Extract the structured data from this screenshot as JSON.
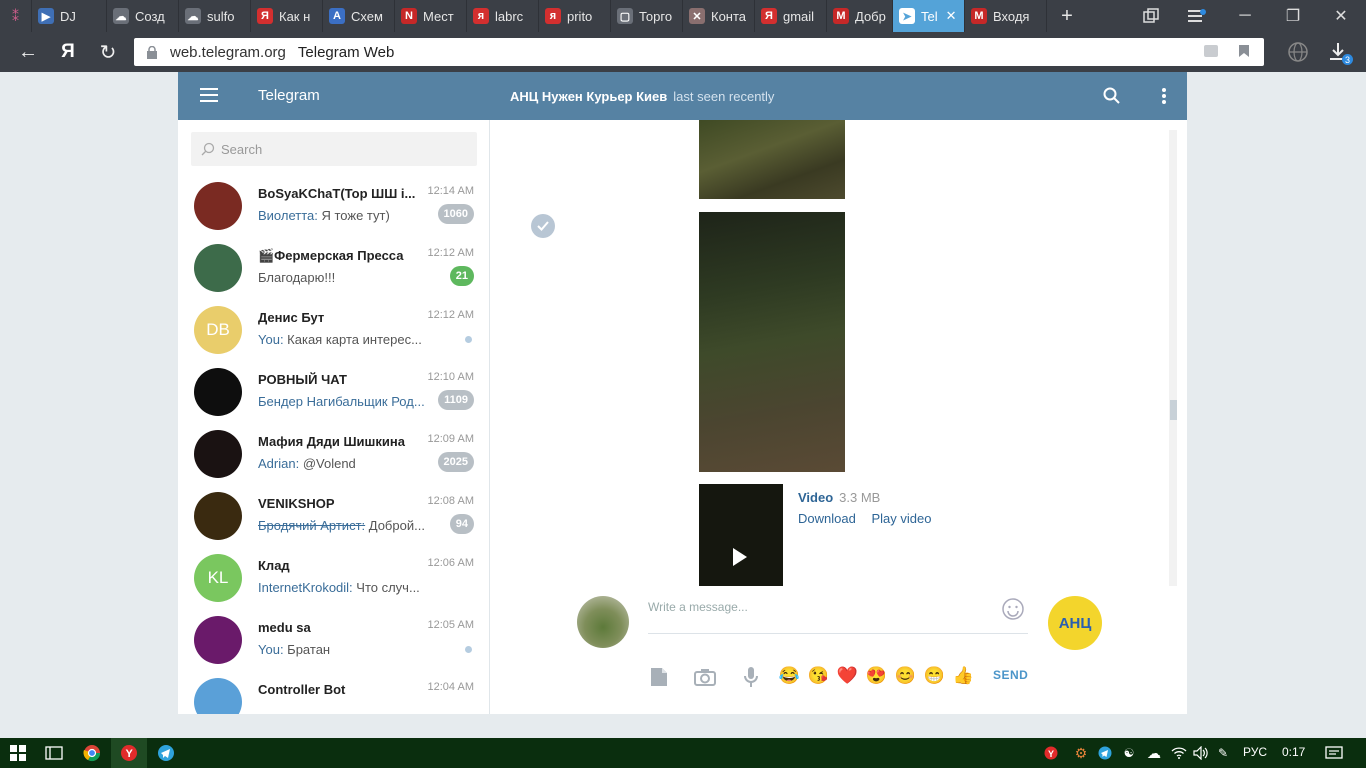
{
  "browser": {
    "tabs": [
      {
        "label": "DJ",
        "fav_color": "#3f6fb5",
        "fav_glyph": "▶"
      },
      {
        "label": "Созд",
        "fav_color": "#6a6f78",
        "fav_glyph": "☁"
      },
      {
        "label": "sulfo",
        "fav_color": "#6a6f78",
        "fav_glyph": "☁"
      },
      {
        "label": "Как н",
        "fav_color": "#d32f2f",
        "fav_glyph": "Я"
      },
      {
        "label": "Схем",
        "fav_color": "#3b6fc4",
        "fav_glyph": "A"
      },
      {
        "label": "Мест",
        "fav_color": "#c62828",
        "fav_glyph": "N"
      },
      {
        "label": "labrc",
        "fav_color": "#d32f2f",
        "fav_glyph": "я"
      },
      {
        "label": "prito",
        "fav_color": "#d32f2f",
        "fav_glyph": "я"
      },
      {
        "label": "Торго",
        "fav_color": "#6a6f78",
        "fav_glyph": "▢"
      },
      {
        "label": "Конта",
        "fav_color": "#8a6f6f",
        "fav_glyph": "✕"
      },
      {
        "label": "gmail",
        "fav_color": "#d32f2f",
        "fav_glyph": "Я"
      },
      {
        "label": "Добр",
        "fav_color": "#c62828",
        "fav_glyph": "M"
      },
      {
        "label": "Tel",
        "fav_color": "#ffffff",
        "fav_glyph": "➤",
        "active": true
      },
      {
        "label": "Входя",
        "fav_color": "#c62828",
        "fav_glyph": "M"
      }
    ],
    "new_tab": "+",
    "address_host": "web.telegram.org",
    "address_title": "Telegram Web",
    "downloads_count": "3"
  },
  "telegram": {
    "brand": "Telegram",
    "peer_name": "АНЦ Нужен Курьер Киев",
    "peer_status": "last seen recently",
    "search_placeholder": "Search",
    "dialogs": [
      {
        "name": "BoSyaKChaT(Top ШШ i...",
        "time": "12:14 AM",
        "from": "Виолетта:",
        "text": " Я тоже тут)",
        "badge": "1060",
        "avatar_color": "#7a2a22",
        "initials": ""
      },
      {
        "name": "🎬Фермерская Пресса",
        "time": "12:12 AM",
        "from": "",
        "text": "Благодарю!!!",
        "badge": "21",
        "badge_green": true,
        "avatar_color": "#3d6b4a",
        "initials": ""
      },
      {
        "name": "Денис Бут",
        "time": "12:12 AM",
        "from": "You:",
        "text": " Какая карта интерес...",
        "dot": true,
        "avatar_color": "#e9cd6b",
        "initials": "DB"
      },
      {
        "name": "РОВНЫЙ ЧАТ",
        "time": "12:10 AM",
        "from": "Бендер Нагибальщик Род...",
        "text": "",
        "badge": "1109",
        "avatar_color": "#0e0e0e",
        "initials": ""
      },
      {
        "name": "Мафия Дяди Шишкина",
        "time": "12:09 AM",
        "from": "Adrian:",
        "text": " @Volend",
        "badge": "2025",
        "avatar_color": "#1a1212",
        "initials": ""
      },
      {
        "name": "VENIKSHOP",
        "time": "12:08 AM",
        "strike": "Бродячий Артист:",
        "text": " Доброй...",
        "badge": "94",
        "avatar_color": "#3a2a10",
        "initials": ""
      },
      {
        "name": "Клад",
        "time": "12:06 AM",
        "from": "InternetKrokodil:",
        "text": " Что случ...",
        "avatar_color": "#7ac75f",
        "initials": "KL"
      },
      {
        "name": "medu sa",
        "time": "12:05 AM",
        "from": "You:",
        "text": " Братан",
        "dot": true,
        "avatar_color": "#6a1a6a",
        "initials": ""
      },
      {
        "name": "Controller Bot",
        "time": "12:04 AM",
        "from": "",
        "text": "",
        "avatar_color": "#5aa0d8",
        "initials": ""
      }
    ],
    "video": {
      "title": "Video",
      "size": "3.3 MB",
      "download": "Download",
      "play": "Play video"
    },
    "composer": {
      "placeholder": "Write a message...",
      "emojis": [
        "😂",
        "😘",
        "❤️",
        "😍",
        "😊",
        "😁",
        "👍"
      ],
      "send": "SEND",
      "peer_avatar_text": "АНЦ"
    }
  },
  "taskbar": {
    "language": "РУС",
    "time": "0:17"
  }
}
